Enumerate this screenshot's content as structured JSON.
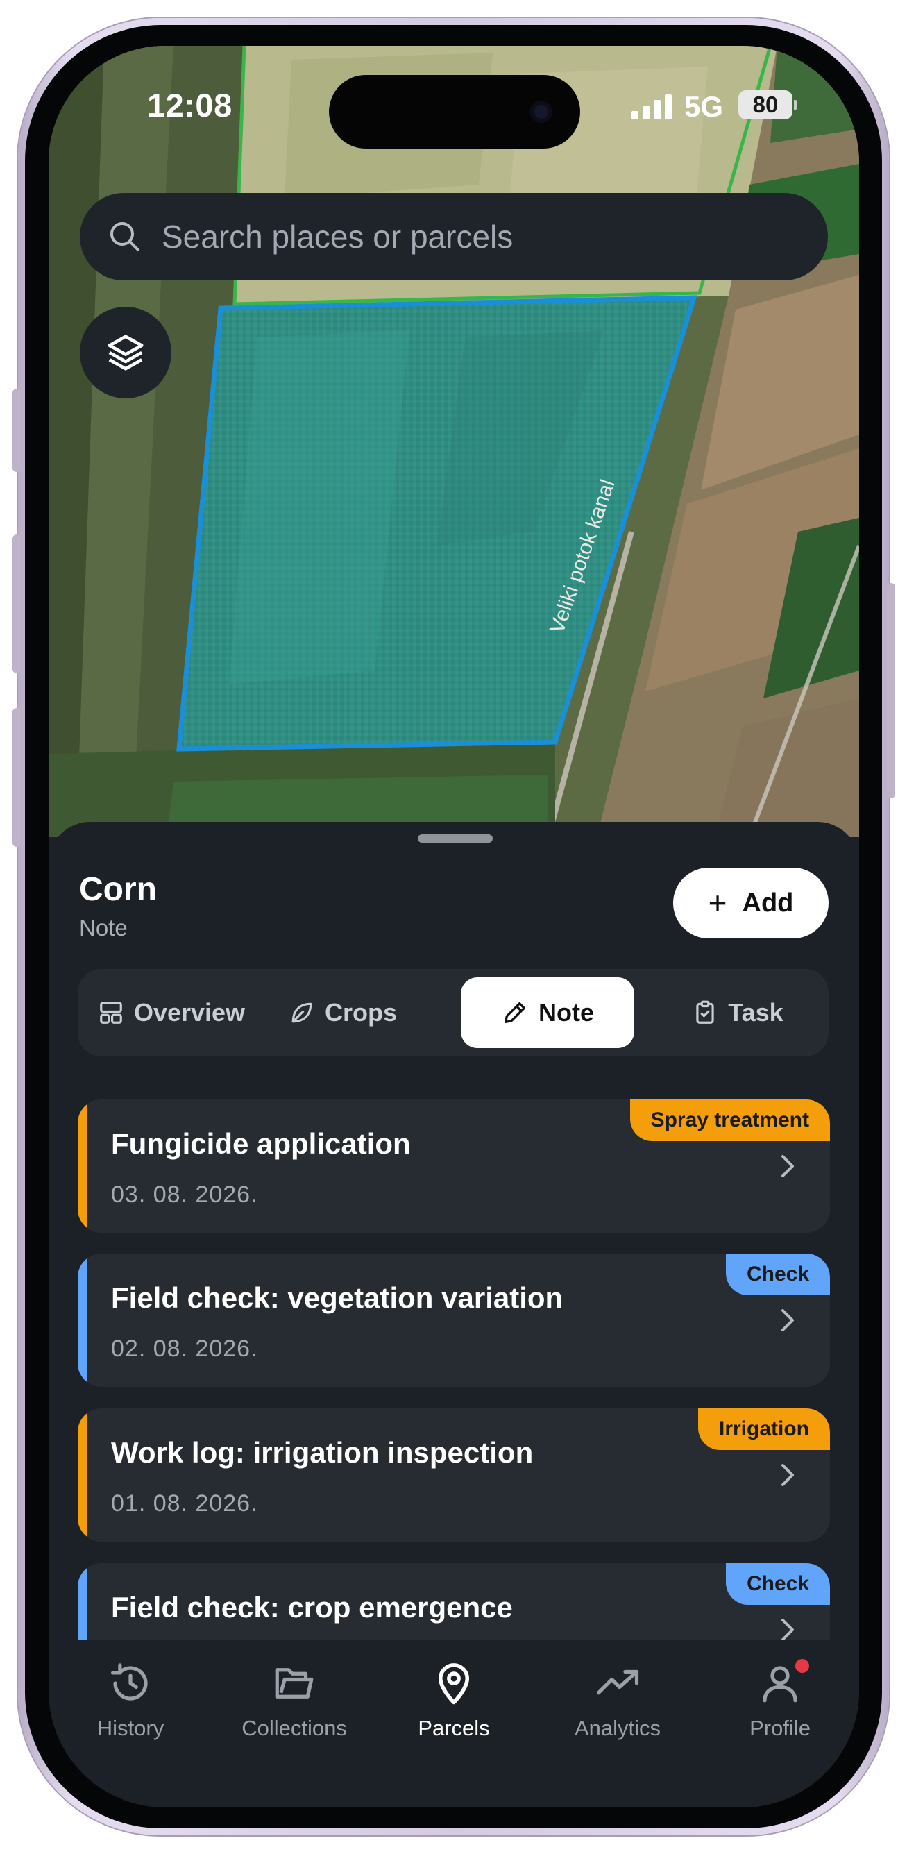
{
  "status_bar": {
    "time": "12:08",
    "network": "5G",
    "battery": "80"
  },
  "search": {
    "placeholder": "Search places or parcels"
  },
  "map": {
    "road_label": "Veliki potok kanal",
    "parcel_color": "#1a8fd6",
    "neighbor_outline": "#39b54a"
  },
  "sheet": {
    "title": "Corn",
    "subtitle": "Note",
    "add_label": "Add",
    "tabs": [
      {
        "label": "Overview",
        "icon": "layout-icon",
        "active": false
      },
      {
        "label": "Crops",
        "icon": "leaf-icon",
        "active": false
      },
      {
        "label": "Note",
        "icon": "pencil-icon",
        "active": true
      },
      {
        "label": "Task",
        "icon": "clipboard-check-icon",
        "active": false
      }
    ],
    "notes": [
      {
        "title": "Fungicide application",
        "date": "03. 08. 2026.",
        "badge": "Spray treatment",
        "color": "#f59e0b"
      },
      {
        "title": "Field check: vegetation variation",
        "date": "02. 08. 2026.",
        "badge": "Check",
        "color": "#60a5fa"
      },
      {
        "title": "Work log: irrigation inspection",
        "date": "01. 08. 2026.",
        "badge": "Irrigation",
        "color": "#f59e0b"
      },
      {
        "title": "Field check: crop emergence",
        "date": "",
        "badge": "Check",
        "color": "#60a5fa"
      }
    ]
  },
  "nav": {
    "items": [
      {
        "label": "History",
        "icon": "history-icon",
        "active": false
      },
      {
        "label": "Collections",
        "icon": "folder-icon",
        "active": false
      },
      {
        "label": "Parcels",
        "icon": "map-pin-icon",
        "active": true
      },
      {
        "label": "Analytics",
        "icon": "trend-icon",
        "active": false
      },
      {
        "label": "Profile",
        "icon": "user-icon",
        "active": false,
        "notification": true
      }
    ]
  }
}
